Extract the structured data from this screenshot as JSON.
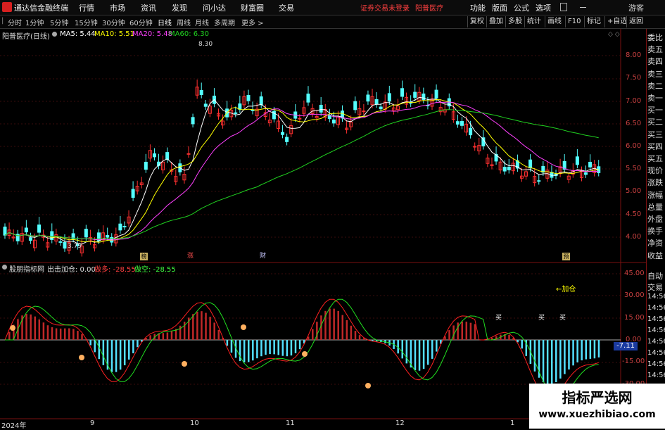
{
  "app": {
    "name": "通达信金融终端"
  },
  "menu": [
    "行情",
    "市场",
    "资讯",
    "发现",
    "问小达",
    "财富圈",
    "交易"
  ],
  "notice": "证券交易未登录",
  "stock_name_top": "阳普医疗",
  "menu_right": [
    "功能",
    "版面",
    "公式",
    "选项"
  ],
  "guest": "游客",
  "periods": [
    "分时",
    "1分钟",
    "5分钟",
    "15分钟",
    "30分钟",
    "60分钟",
    "日线",
    "周线",
    "月线",
    "多周期",
    "更多 >"
  ],
  "active_period": "日线",
  "toolbar_right": [
    "复权",
    "叠加",
    "多股",
    "统计",
    "画线",
    "F10",
    "标记",
    "+自选",
    "返回"
  ],
  "main_chart": {
    "title": "阳普医疗(日线)",
    "ma": [
      {
        "label": "MA5: 5.44",
        "color": "#ffffff"
      },
      {
        "label": "MA10: 5.51",
        "color": "#ffff00"
      },
      {
        "label": "MA20: 5.48",
        "color": "#ff40ff"
      },
      {
        "label": "MA60: 6.30",
        "color": "#20d020"
      }
    ],
    "max_label": "8.30",
    "min_label": "3.79",
    "y_ticks": [
      "8.00",
      "7.50",
      "7.00",
      "6.50",
      "6.00",
      "5.50",
      "5.00",
      "4.50",
      "4.00"
    ],
    "markers": [
      "榜",
      "涨",
      "财",
      "预"
    ]
  },
  "sub_chart": {
    "title": "股朋指标网",
    "params": "出击加仓: 0.00",
    "long_label": "做多: -28.55",
    "short_label": "做空: -28.55",
    "y_ticks": [
      "45.00",
      "30.00",
      "15.00",
      "0.00",
      "-15.00",
      "-30.00"
    ],
    "current_value": "-7.11",
    "annotations": {
      "add": "←加仓",
      "buy": "买"
    }
  },
  "x_axis": [
    "2024年",
    "9",
    "10",
    "11",
    "12",
    "1"
  ],
  "right_panel_top": [
    "委比",
    "卖五",
    "卖四",
    "卖三",
    "卖二",
    "卖一",
    "买一",
    "买二",
    "买三",
    "买四",
    "买五",
    "现价",
    "涨跌",
    "涨幅",
    "总量",
    "外盘",
    "换手",
    "净资",
    "收益"
  ],
  "right_panel_bottom": [
    "自动",
    "交易",
    "14:56",
    "14:56",
    "14:56",
    "14:56",
    "14:56",
    "14:56",
    "14:56",
    "14:56"
  ],
  "watermark": {
    "title": "指标严选网",
    "url": "www.xuezhibiao.com"
  },
  "colors": {
    "up": "#ff3030",
    "down": "#54ffff",
    "ma5": "#ffffff",
    "ma10": "#ffff00",
    "ma20": "#ff40ff",
    "ma60": "#20d020",
    "axis_red": "#c84040"
  }
}
